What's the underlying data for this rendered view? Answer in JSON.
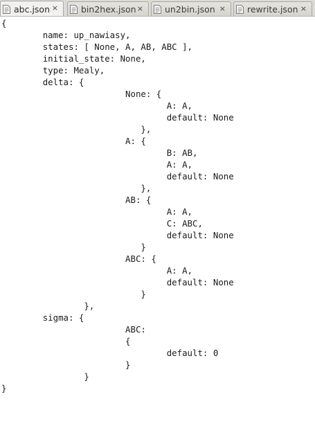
{
  "tabs": [
    {
      "label": "abc.json",
      "close": "×",
      "active": true
    },
    {
      "label": "bin2hex.json",
      "close": "×",
      "active": false
    },
    {
      "label": "un2bin.json",
      "close": "×",
      "active": false
    },
    {
      "label": "rewrite.json",
      "close": "×",
      "active": false
    }
  ],
  "icons": {
    "tab_icon": "document-icon",
    "close_icon": "close-icon"
  },
  "editor": {
    "lines": [
      "{",
      "\tname: up_nawiasy,",
      "\tstates: [ None, A, AB, ABC ],",
      "\tinitial_state: None,",
      "\ttype: Mealy,",
      "\tdelta: {",
      "\t\t\tNone: {",
      "\t\t\t\tA: A,",
      "\t\t\t\tdefault: None",
      "\t\t\t   },",
      "\t\t\tA: {",
      "\t\t\t\tB: AB,",
      "\t\t\t\tA: A,",
      "\t\t\t\tdefault: None",
      "\t\t\t   },",
      "\t\t\tAB: {",
      "\t\t\t\tA: A,",
      "\t\t\t\tC: ABC,",
      "\t\t\t\tdefault: None",
      "\t\t\t   }",
      "\t\t\tABC: {",
      "\t\t\t\tA: A,",
      "\t\t\t\tdefault: None",
      "\t\t\t   }",
      "\t\t},",
      "\tsigma: {",
      "\t\t\tABC:",
      "\t\t\t{",
      "\t\t\t\tdefault: 0",
      "\t\t\t}",
      "\t\t}",
      "}"
    ]
  }
}
